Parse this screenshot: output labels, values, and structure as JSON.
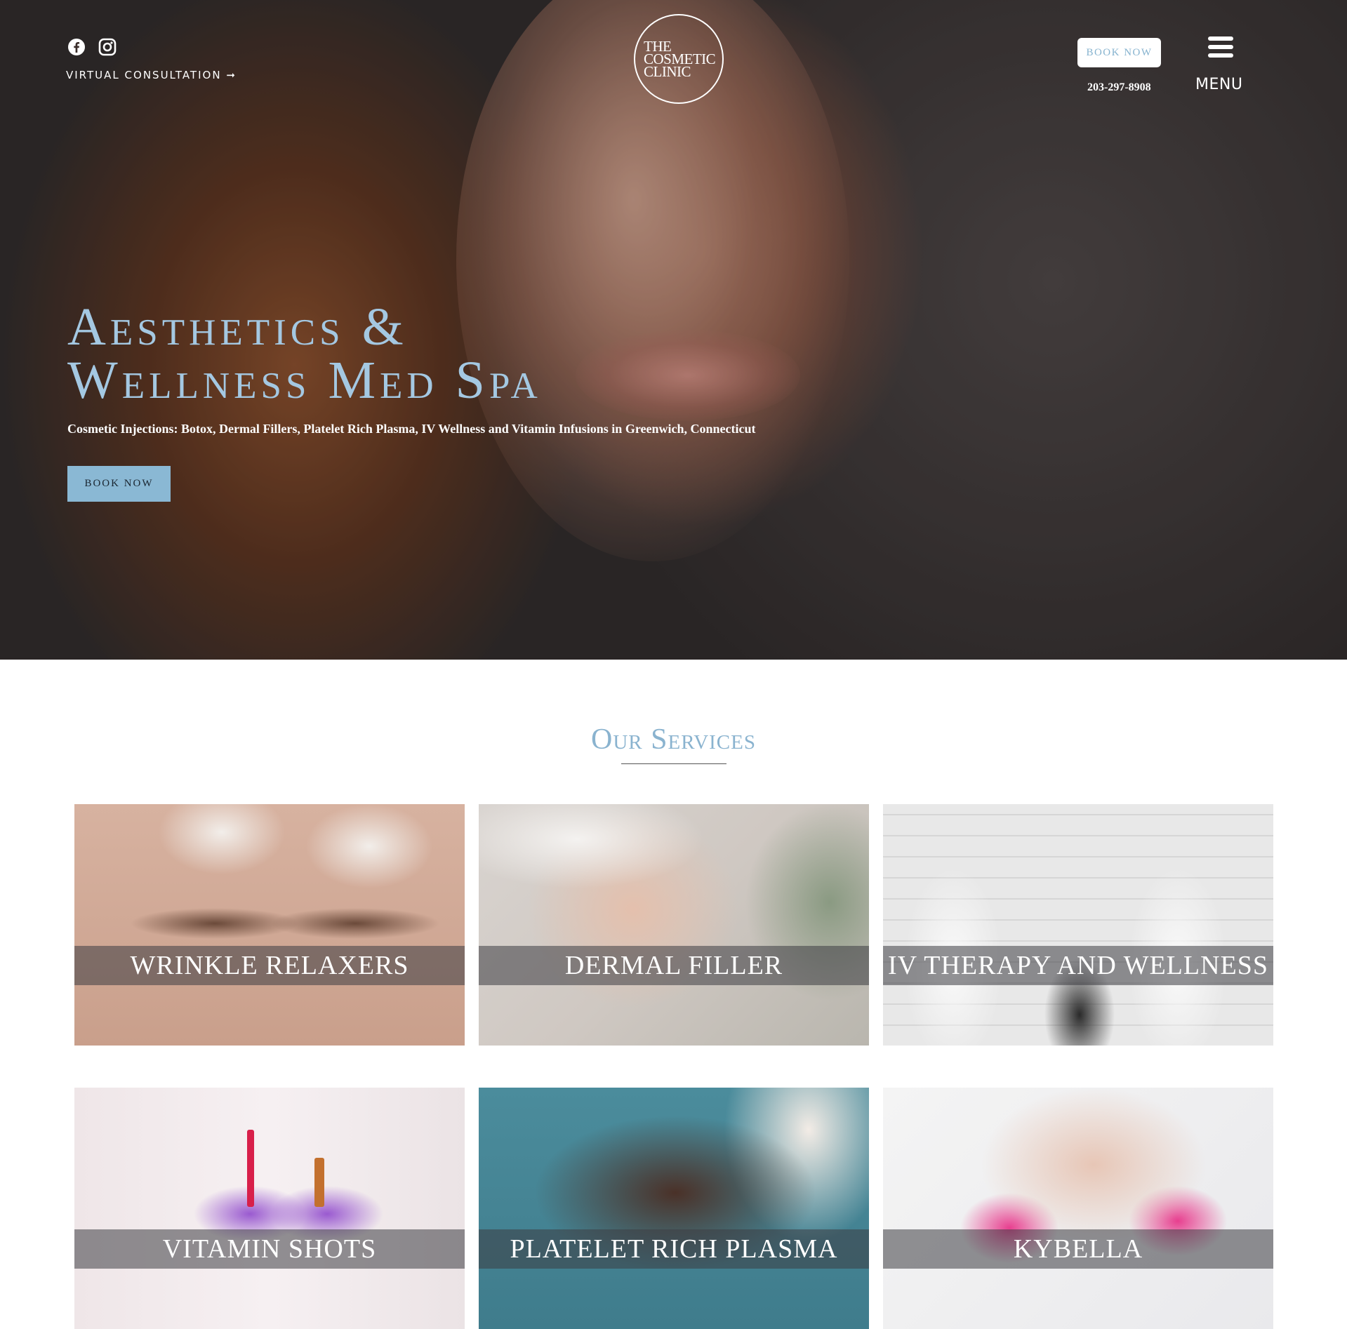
{
  "header": {
    "social_icons": [
      "facebook-icon",
      "instagram-icon"
    ],
    "virtual_consultation": "VIRTUAL CONSULTATION ➞",
    "logo_lines": [
      "THE",
      "COSMETIC",
      "CLINIC"
    ],
    "book_now_label": "BOOK NOW",
    "phone": "203-297-8908",
    "menu_icon": "hamburger-icon",
    "menu_label": "MENU"
  },
  "hero": {
    "title_line1": "Aesthetics &",
    "title_line2": "Wellness Med Spa",
    "subtitle": "Cosmetic Injections: Botox, Dermal Fillers, Platelet Rich Plasma, IV Wellness and Vitamin Infusions in Greenwich, Connecticut",
    "book_now_label": "BOOK NOW"
  },
  "services": {
    "title": "Our Services",
    "items": [
      {
        "label": "WRINKLE RELAXERS"
      },
      {
        "label": "DERMAL FILLER"
      },
      {
        "label": "IV THERAPY AND WELLNESS"
      },
      {
        "label": "VITAMIN SHOTS"
      },
      {
        "label": "PLATELET RICH PLASMA"
      },
      {
        "label": "KYBELLA"
      }
    ]
  },
  "colors": {
    "accent_blue": "#8ab8d4",
    "title_blue": "#a4c8e2",
    "white": "#ffffff"
  }
}
